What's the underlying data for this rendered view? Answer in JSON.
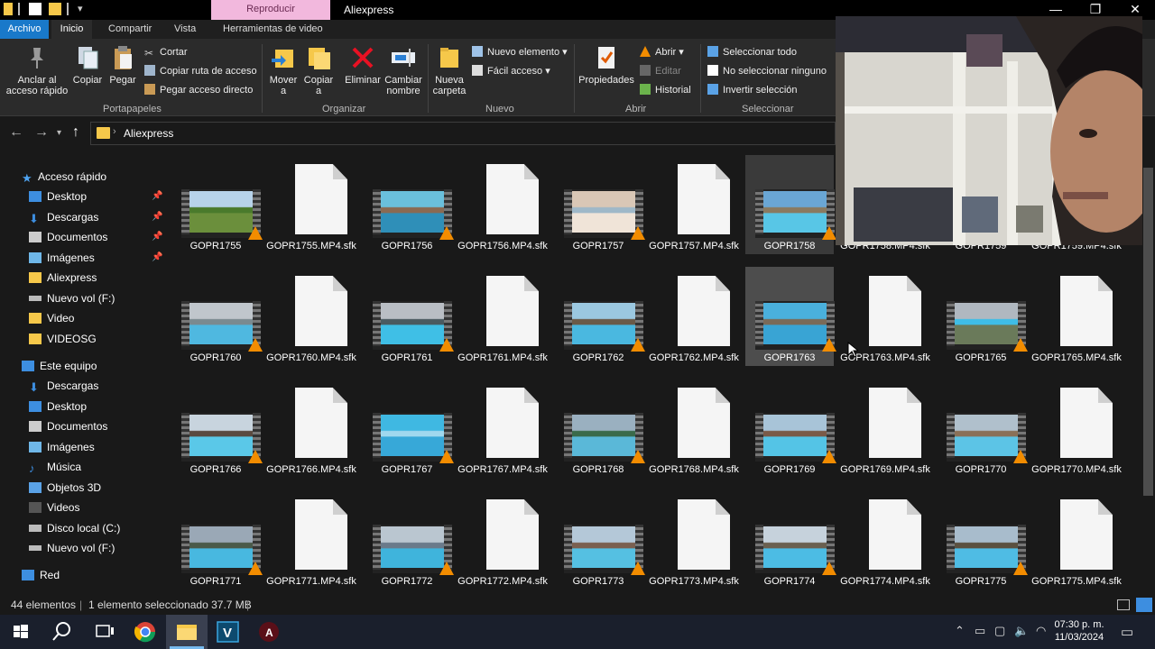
{
  "window": {
    "title": "Aliexpress",
    "context_tab": "Reproducir"
  },
  "ribbon_tabs": [
    "Archivo",
    "Inicio",
    "Compartir",
    "Vista",
    "Herramientas de video"
  ],
  "ribbon": {
    "portapapeles": {
      "label": "Portapapeles",
      "anclar": "Anclar al acceso rápido",
      "copiar": "Copiar",
      "pegar": "Pegar",
      "cortar": "Cortar",
      "copiar_ruta": "Copiar ruta de acceso",
      "pegar_acceso": "Pegar acceso directo"
    },
    "organizar": {
      "label": "Organizar",
      "mover": "Mover",
      "copiar_a": "Copiar",
      "a": "a",
      "eliminar": "Eliminar",
      "cambiar": "Cambiar nombre"
    },
    "nuevo": {
      "label": "Nuevo",
      "carpeta": "Nueva carpeta",
      "elemento": "Nuevo elemento",
      "facil": "Fácil acceso"
    },
    "abrir": {
      "label": "Abrir",
      "propiedades": "Propiedades",
      "abrir": "Abrir",
      "editar": "Editar",
      "historial": "Historial"
    },
    "seleccionar": {
      "label": "Seleccionar",
      "todo": "Seleccionar todo",
      "ninguno": "No seleccionar ninguno",
      "invertir": "Invertir selección"
    }
  },
  "address": {
    "path": "Aliexpress"
  },
  "sidebar": {
    "items": [
      {
        "label": "Acceso rápido"
      },
      {
        "label": "Desktop"
      },
      {
        "label": "Descargas"
      },
      {
        "label": "Documentos"
      },
      {
        "label": "Imágenes"
      },
      {
        "label": "Aliexpress"
      },
      {
        "label": "Nuevo vol (F:)"
      },
      {
        "label": "Video"
      },
      {
        "label": "VIDEOSG"
      },
      {
        "label": "Este equipo"
      },
      {
        "label": "Descargas"
      },
      {
        "label": "Desktop"
      },
      {
        "label": "Documentos"
      },
      {
        "label": "Imágenes"
      },
      {
        "label": "Música"
      },
      {
        "label": "Objetos 3D"
      },
      {
        "label": "Videos"
      },
      {
        "label": "Disco local (C:)"
      },
      {
        "label": "Nuevo vol (F:)"
      },
      {
        "label": "Red"
      }
    ]
  },
  "files": [
    [
      "GOPR1755",
      "GOPR1755.MP4.sfk",
      "GOPR1756",
      "GOPR1756.MP4.sfk",
      "GOPR1757",
      "GOPR1757.MP4.sfk",
      "GOPR1758",
      "GOPR1758.MP4.sfk",
      "GOPR1759",
      "GOPR1759.MP4.sfk"
    ],
    [
      "GOPR1760",
      "GOPR1760.MP4.sfk",
      "GOPR1761",
      "GOPR1761.MP4.sfk",
      "GOPR1762",
      "GOPR1762.MP4.sfk",
      "GOPR1763",
      "GOPR1763.MP4.sfk",
      "GOPR1765",
      "GOPR1765.MP4.sfk"
    ],
    [
      "GOPR1766",
      "GOPR1766.MP4.sfk",
      "GOPR1767",
      "GOPR1767.MP4.sfk",
      "GOPR1768",
      "GOPR1768.MP4.sfk",
      "GOPR1769",
      "GOPR1769.MP4.sfk",
      "GOPR1770",
      "GOPR1770.MP4.sfk"
    ],
    [
      "GOPR1771",
      "GOPR1771.MP4.sfk",
      "GOPR1772",
      "GOPR1772.MP4.sfk",
      "GOPR1773",
      "GOPR1773.MP4.sfk",
      "GOPR1774",
      "GOPR1774.MP4.sfk",
      "GOPR1775",
      "GOPR1775.MP4.sfk"
    ]
  ],
  "status": {
    "count": "44 elementos",
    "selected": "1 elemento seleccionado  37.7 MB"
  },
  "taskbar": {
    "time": "07:30 p. m.",
    "date": "11/03/2024"
  },
  "colors": {
    "accent": "#1979ca",
    "folder": "#f6c84a",
    "vlc": "#f28c00",
    "background": "#191919",
    "ribbon": "#2b2b2b"
  }
}
